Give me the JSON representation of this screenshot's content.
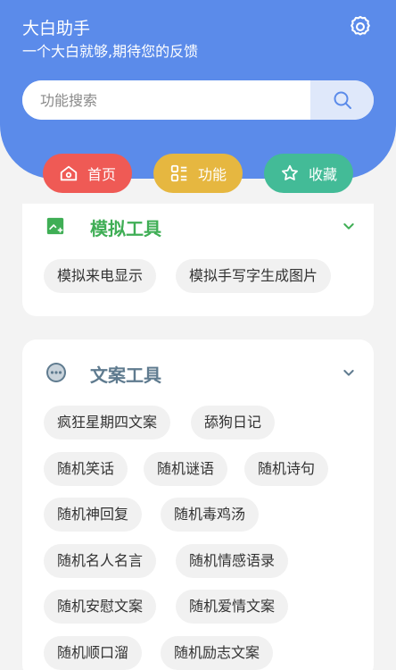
{
  "header": {
    "title": "大白助手",
    "subtitle": "一个大白就够,期待您的反馈",
    "settings_icon": "gear-icon"
  },
  "search": {
    "placeholder": "功能搜索",
    "value": "",
    "button_icon": "search-icon"
  },
  "nav": [
    {
      "label": "首页",
      "icon": "home-icon",
      "color": "#ef5a55"
    },
    {
      "label": "功能",
      "icon": "apps-icon",
      "color": "#e6b740"
    },
    {
      "label": "收藏",
      "icon": "star-icon",
      "color": "#43bb97"
    }
  ],
  "sections": [
    {
      "title": "模拟工具",
      "icon": "image-add-icon",
      "color": "#3fae55",
      "items": [
        "模拟来电显示",
        "模拟手写字生成图片"
      ]
    },
    {
      "title": "文案工具",
      "icon": "more-circle-icon",
      "color": "#5f7b8f",
      "items": [
        "疯狂星期四文案",
        "舔狗日记",
        "随机笑话",
        "随机谜语",
        "随机诗句",
        "随机神回复",
        "随机毒鸡汤",
        "随机名人名言",
        "随机情感语录",
        "随机安慰文案",
        "随机爱情文案",
        "随机顺口溜",
        "随机励志文案"
      ]
    }
  ],
  "colors": {
    "header_bg": "#5b8bea",
    "page_bg": "#f3f3f3",
    "tag_bg": "#f1f1f1"
  }
}
